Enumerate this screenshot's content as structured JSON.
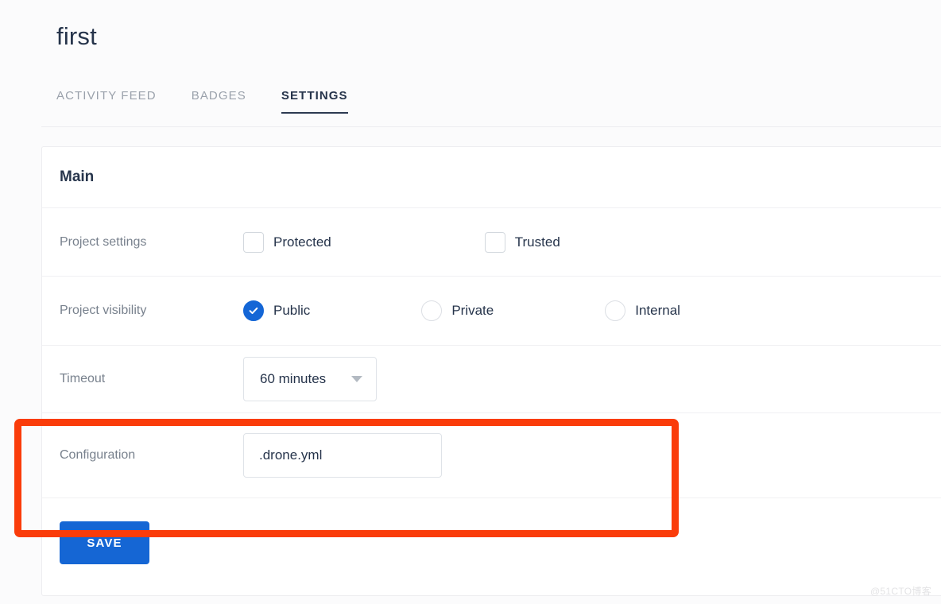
{
  "header": {
    "title": "first",
    "tabs": [
      {
        "label": "ACTIVITY FEED",
        "active": false
      },
      {
        "label": "BADGES",
        "active": false
      },
      {
        "label": "SETTINGS",
        "active": true
      }
    ]
  },
  "card": {
    "section_title": "Main",
    "rows": {
      "project_settings": {
        "label": "Project settings",
        "options": [
          {
            "label": "Protected",
            "checked": false
          },
          {
            "label": "Trusted",
            "checked": false
          }
        ]
      },
      "project_visibility": {
        "label": "Project visibility",
        "options": [
          {
            "label": "Public",
            "selected": true
          },
          {
            "label": "Private",
            "selected": false
          },
          {
            "label": "Internal",
            "selected": false
          }
        ]
      },
      "timeout": {
        "label": "Timeout",
        "value": "60 minutes",
        "caret_icon": "chevron-down-icon"
      },
      "configuration": {
        "label": "Configuration",
        "value": ".drone.yml",
        "placeholder": ".drone.yml"
      }
    },
    "save_label": "SAVE"
  },
  "annotation": {
    "color": "#fa3c0a",
    "shape": "rectangle-highlight",
    "targets": "configuration-row"
  },
  "watermark": "@51CTO博客",
  "colors": {
    "accent_blue": "#1566d4",
    "annotation_orange": "#fa3c0a",
    "text_dark": "#26344b",
    "text_muted": "#78818d",
    "page_bg": "#fbfbfc",
    "card_bg": "#ffffff",
    "border": "#ededf0"
  }
}
